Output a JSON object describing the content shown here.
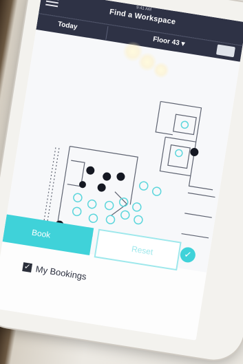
{
  "app": {
    "title": "Find a Workspace",
    "status_time": "9:41 AM"
  },
  "tabs": {
    "today_label": "Today",
    "floor_label": "Floor 43 ▾"
  },
  "actions": {
    "book_label": "Book",
    "reset_label": "Reset"
  },
  "bookings": {
    "checkbox_checked": true,
    "label": "My Bookings"
  },
  "colors": {
    "header": "#2e3245",
    "accent": "#3fd2d9",
    "occupied": "#151822",
    "available_outline": "#5cd6dc"
  },
  "icons": {
    "menu": "hamburger-menu-icon",
    "check": "checkmark-icon"
  }
}
